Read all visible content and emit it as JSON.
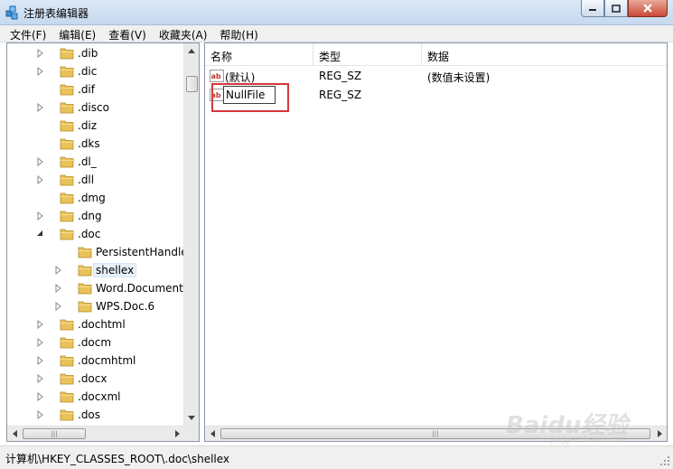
{
  "window": {
    "title": "注册表编辑器"
  },
  "menu": [
    "文件(F)",
    "编辑(E)",
    "查看(V)",
    "收藏夹(A)",
    "帮助(H)"
  ],
  "tree": [
    {
      "label": ".dib",
      "depth": 0,
      "expander": "collapsed"
    },
    {
      "label": ".dic",
      "depth": 0,
      "expander": "collapsed"
    },
    {
      "label": ".dif",
      "depth": 0,
      "expander": "none"
    },
    {
      "label": ".disco",
      "depth": 0,
      "expander": "collapsed"
    },
    {
      "label": ".diz",
      "depth": 0,
      "expander": "none"
    },
    {
      "label": ".dks",
      "depth": 0,
      "expander": "none"
    },
    {
      "label": ".dl_",
      "depth": 0,
      "expander": "collapsed"
    },
    {
      "label": ".dll",
      "depth": 0,
      "expander": "collapsed"
    },
    {
      "label": ".dmg",
      "depth": 0,
      "expander": "none"
    },
    {
      "label": ".dng",
      "depth": 0,
      "expander": "collapsed"
    },
    {
      "label": ".doc",
      "depth": 0,
      "expander": "expanded"
    },
    {
      "label": "PersistentHandle",
      "depth": 1,
      "expander": "none"
    },
    {
      "label": "shellex",
      "depth": 1,
      "expander": "collapsed",
      "selected": true
    },
    {
      "label": "Word.Document",
      "depth": 1,
      "expander": "collapsed"
    },
    {
      "label": "WPS.Doc.6",
      "depth": 1,
      "expander": "collapsed"
    },
    {
      "label": ".dochtml",
      "depth": 0,
      "expander": "collapsed"
    },
    {
      "label": ".docm",
      "depth": 0,
      "expander": "collapsed"
    },
    {
      "label": ".docmhtml",
      "depth": 0,
      "expander": "collapsed"
    },
    {
      "label": ".docx",
      "depth": 0,
      "expander": "collapsed"
    },
    {
      "label": ".docxml",
      "depth": 0,
      "expander": "collapsed"
    },
    {
      "label": ".dos",
      "depth": 0,
      "expander": "collapsed"
    }
  ],
  "values": {
    "columns": {
      "name": "名称",
      "type": "类型",
      "data": "数据"
    },
    "rows": [
      {
        "name": "(默认)",
        "type": "REG_SZ",
        "data": "(数值未设置)"
      },
      {
        "name": "NullFile",
        "type": "REG_SZ",
        "data": "",
        "editing": true
      }
    ]
  },
  "status": {
    "path": "计算机\\HKEY_CLASSES_ROOT\\.doc\\shellex"
  },
  "colors": {
    "folder": "#e9c25a",
    "highlight_box": "#d9363e",
    "title_bar": "#c6d9ef"
  },
  "watermark": {
    "logo": "Baidu经验",
    "url": "jingyan.baidu.com"
  }
}
